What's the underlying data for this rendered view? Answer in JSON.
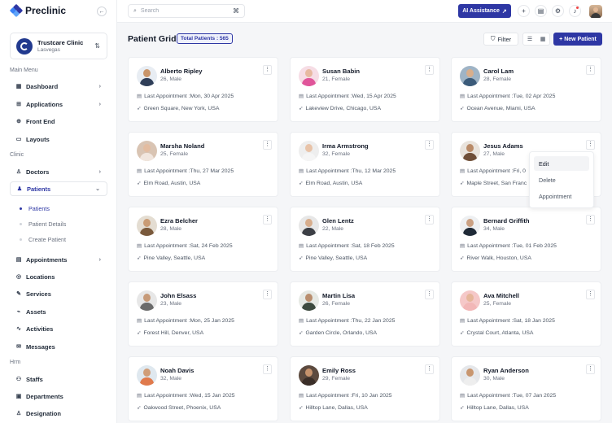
{
  "brand": {
    "name": "Preclinic"
  },
  "clinic": {
    "name": "Trustcare Clinic",
    "location": "Lasvegas"
  },
  "sidebar": {
    "sections": [
      {
        "title": "Main Menu"
      },
      {
        "title": "Clinic"
      },
      {
        "title": "Hrm"
      }
    ],
    "items": [
      {
        "label": "Dashboard",
        "icon": "grid-icon",
        "chevron": "›"
      },
      {
        "label": "Applications",
        "icon": "apps-icon",
        "chevron": "›"
      },
      {
        "label": "Front End",
        "icon": "globe-icon"
      },
      {
        "label": "Layouts",
        "icon": "layout-icon"
      },
      {
        "label": "Doctors",
        "icon": "doctor-icon",
        "chevron": "›"
      },
      {
        "label": "Patients",
        "icon": "patients-icon",
        "chevron": "⌄"
      },
      {
        "label": "Appointments",
        "icon": "calendar-icon",
        "chevron": "›"
      },
      {
        "label": "Locations",
        "icon": "location-icon"
      },
      {
        "label": "Services",
        "icon": "services-icon"
      },
      {
        "label": "Assets",
        "icon": "assets-icon"
      },
      {
        "label": "Activities",
        "icon": "activity-icon"
      },
      {
        "label": "Messages",
        "icon": "message-icon"
      },
      {
        "label": "Staffs",
        "icon": "staff-icon"
      },
      {
        "label": "Departments",
        "icon": "department-icon"
      },
      {
        "label": "Designation",
        "icon": "designation-icon"
      }
    ],
    "sub_items": [
      {
        "label": "Patients"
      },
      {
        "label": "Patient Details"
      },
      {
        "label": "Create Patient"
      }
    ]
  },
  "topbar": {
    "search_placeholder": "Search",
    "shortcut": "⌘",
    "ai_label": "AI Assistance",
    "ai_icon": "↗"
  },
  "page": {
    "title": "Patient Grid",
    "total_label": "Total Patients : 565",
    "filter_label": "Filter",
    "new_label": "New Patient"
  },
  "appointment_prefix": "Last Appointment : ",
  "patients": [
    {
      "name": "Alberto Ripley",
      "meta": "26, Male",
      "appt": "Mon, 30 Apr 2025",
      "addr": "Green Square, New York, USA",
      "skin": "#c9956a",
      "shirt": "#2f3e58",
      "bg": "#e8edf3"
    },
    {
      "name": "Susan Babin",
      "meta": "21, Female",
      "appt": "Wed, 15 Apr 2025",
      "addr": "Lakeview Drive, Chicago, USA",
      "skin": "#e7b9a0",
      "shirt": "#e0559a",
      "bg": "#f6dde5"
    },
    {
      "name": "Carol Lam",
      "meta": "28, Female",
      "appt": "Tue, 02 Apr 2025",
      "addr": "Ocean Avenue, Miami, USA",
      "skin": "#d8ae8c",
      "shirt": "#3b5b7a",
      "bg": "#9fb4c6"
    },
    {
      "name": "Marsha Noland",
      "meta": "25, Female",
      "appt": "Thu, 27 Mar 2025",
      "addr": "Elm Road, Austin, USA",
      "skin": "#e3bca0",
      "shirt": "#f1e6de",
      "bg": "#d9c4b3"
    },
    {
      "name": "Irma Armstrong",
      "meta": "32, Female",
      "appt": "Thu, 12 Mar 2025",
      "addr": "Elm Road, Austin, USA",
      "skin": "#e8c3a8",
      "shirt": "#f5f5f5",
      "bg": "#eeeeee"
    },
    {
      "name": "Jesus Adams",
      "meta": "27, Male",
      "appt": "Fri, 0",
      "addr": "Maple Street, San Franc",
      "skin": "#b98a67",
      "shirt": "#6f4e37",
      "bg": "#e9e3dc"
    },
    {
      "name": "Ezra Belcher",
      "meta": "28, Male",
      "appt": "Sat, 24 Feb 2025",
      "addr": "Pine Valley, Seattle, USA",
      "skin": "#c99b74",
      "shirt": "#7a5a3c",
      "bg": "#e4ddd2"
    },
    {
      "name": "Glen Lentz",
      "meta": "22, Male",
      "appt": "Sat, 18 Feb 2025",
      "addr": "Pine Valley, Seattle, USA",
      "skin": "#d7ad8c",
      "shirt": "#3c3f45",
      "bg": "#e7e7e7"
    },
    {
      "name": "Bernard Griffith",
      "meta": "34, Male",
      "appt": "Tue, 01 Feb 2025",
      "addr": "River Walk, Houston, USA",
      "skin": "#caa082",
      "shirt": "#1f2a37",
      "bg": "#eef0f2"
    },
    {
      "name": "John Elsass",
      "meta": "23, Male",
      "appt": "Mon, 25 Jan 2025",
      "addr": "Forest Hill, Denver, USA",
      "skin": "#c69a78",
      "shirt": "#6b6b6b",
      "bg": "#e7e7e7"
    },
    {
      "name": "Martin Lisa",
      "meta": "26, Female",
      "appt": "Thu, 22 Jan 2025",
      "addr": "Garden Circle, Orlando, USA",
      "skin": "#b98e6e",
      "shirt": "#3d4a3f",
      "bg": "#e6e9e4"
    },
    {
      "name": "Ava Mitchell",
      "meta": "25, Female",
      "appt": "Sat, 18 Jan 2025",
      "addr": "Crystal Court, Atlanta, USA",
      "skin": "#e6b69a",
      "shirt": "#f2b7b7",
      "bg": "#f5c8c8"
    },
    {
      "name": "Noah Davis",
      "meta": "32, Male",
      "appt": "Wed, 15 Jan 2025",
      "addr": "Oakwood Street, Phoenix, USA",
      "skin": "#d09d78",
      "shirt": "#e07a4c",
      "bg": "#dfe8ef"
    },
    {
      "name": "Emily Ross",
      "meta": "29, Female",
      "appt": "Fri, 10 Jan 2025",
      "addr": "Hilltop Lane, Dallas, USA",
      "skin": "#c5926c",
      "shirt": "#3a2e28",
      "bg": "#5c4a3f"
    },
    {
      "name": "Ryan Anderson",
      "meta": "30, Male",
      "appt": "Tue, 07 Jan 2025",
      "addr": "Hilltop Lane, Dallas, USA",
      "skin": "#c8966f",
      "shirt": "#eeeeee",
      "bg": "#e5e7ea"
    }
  ],
  "dropdown": [
    "Edit",
    "Delete",
    "Appointment"
  ],
  "colors": {
    "primary": "#2e37a4",
    "danger": "#ef4444"
  }
}
